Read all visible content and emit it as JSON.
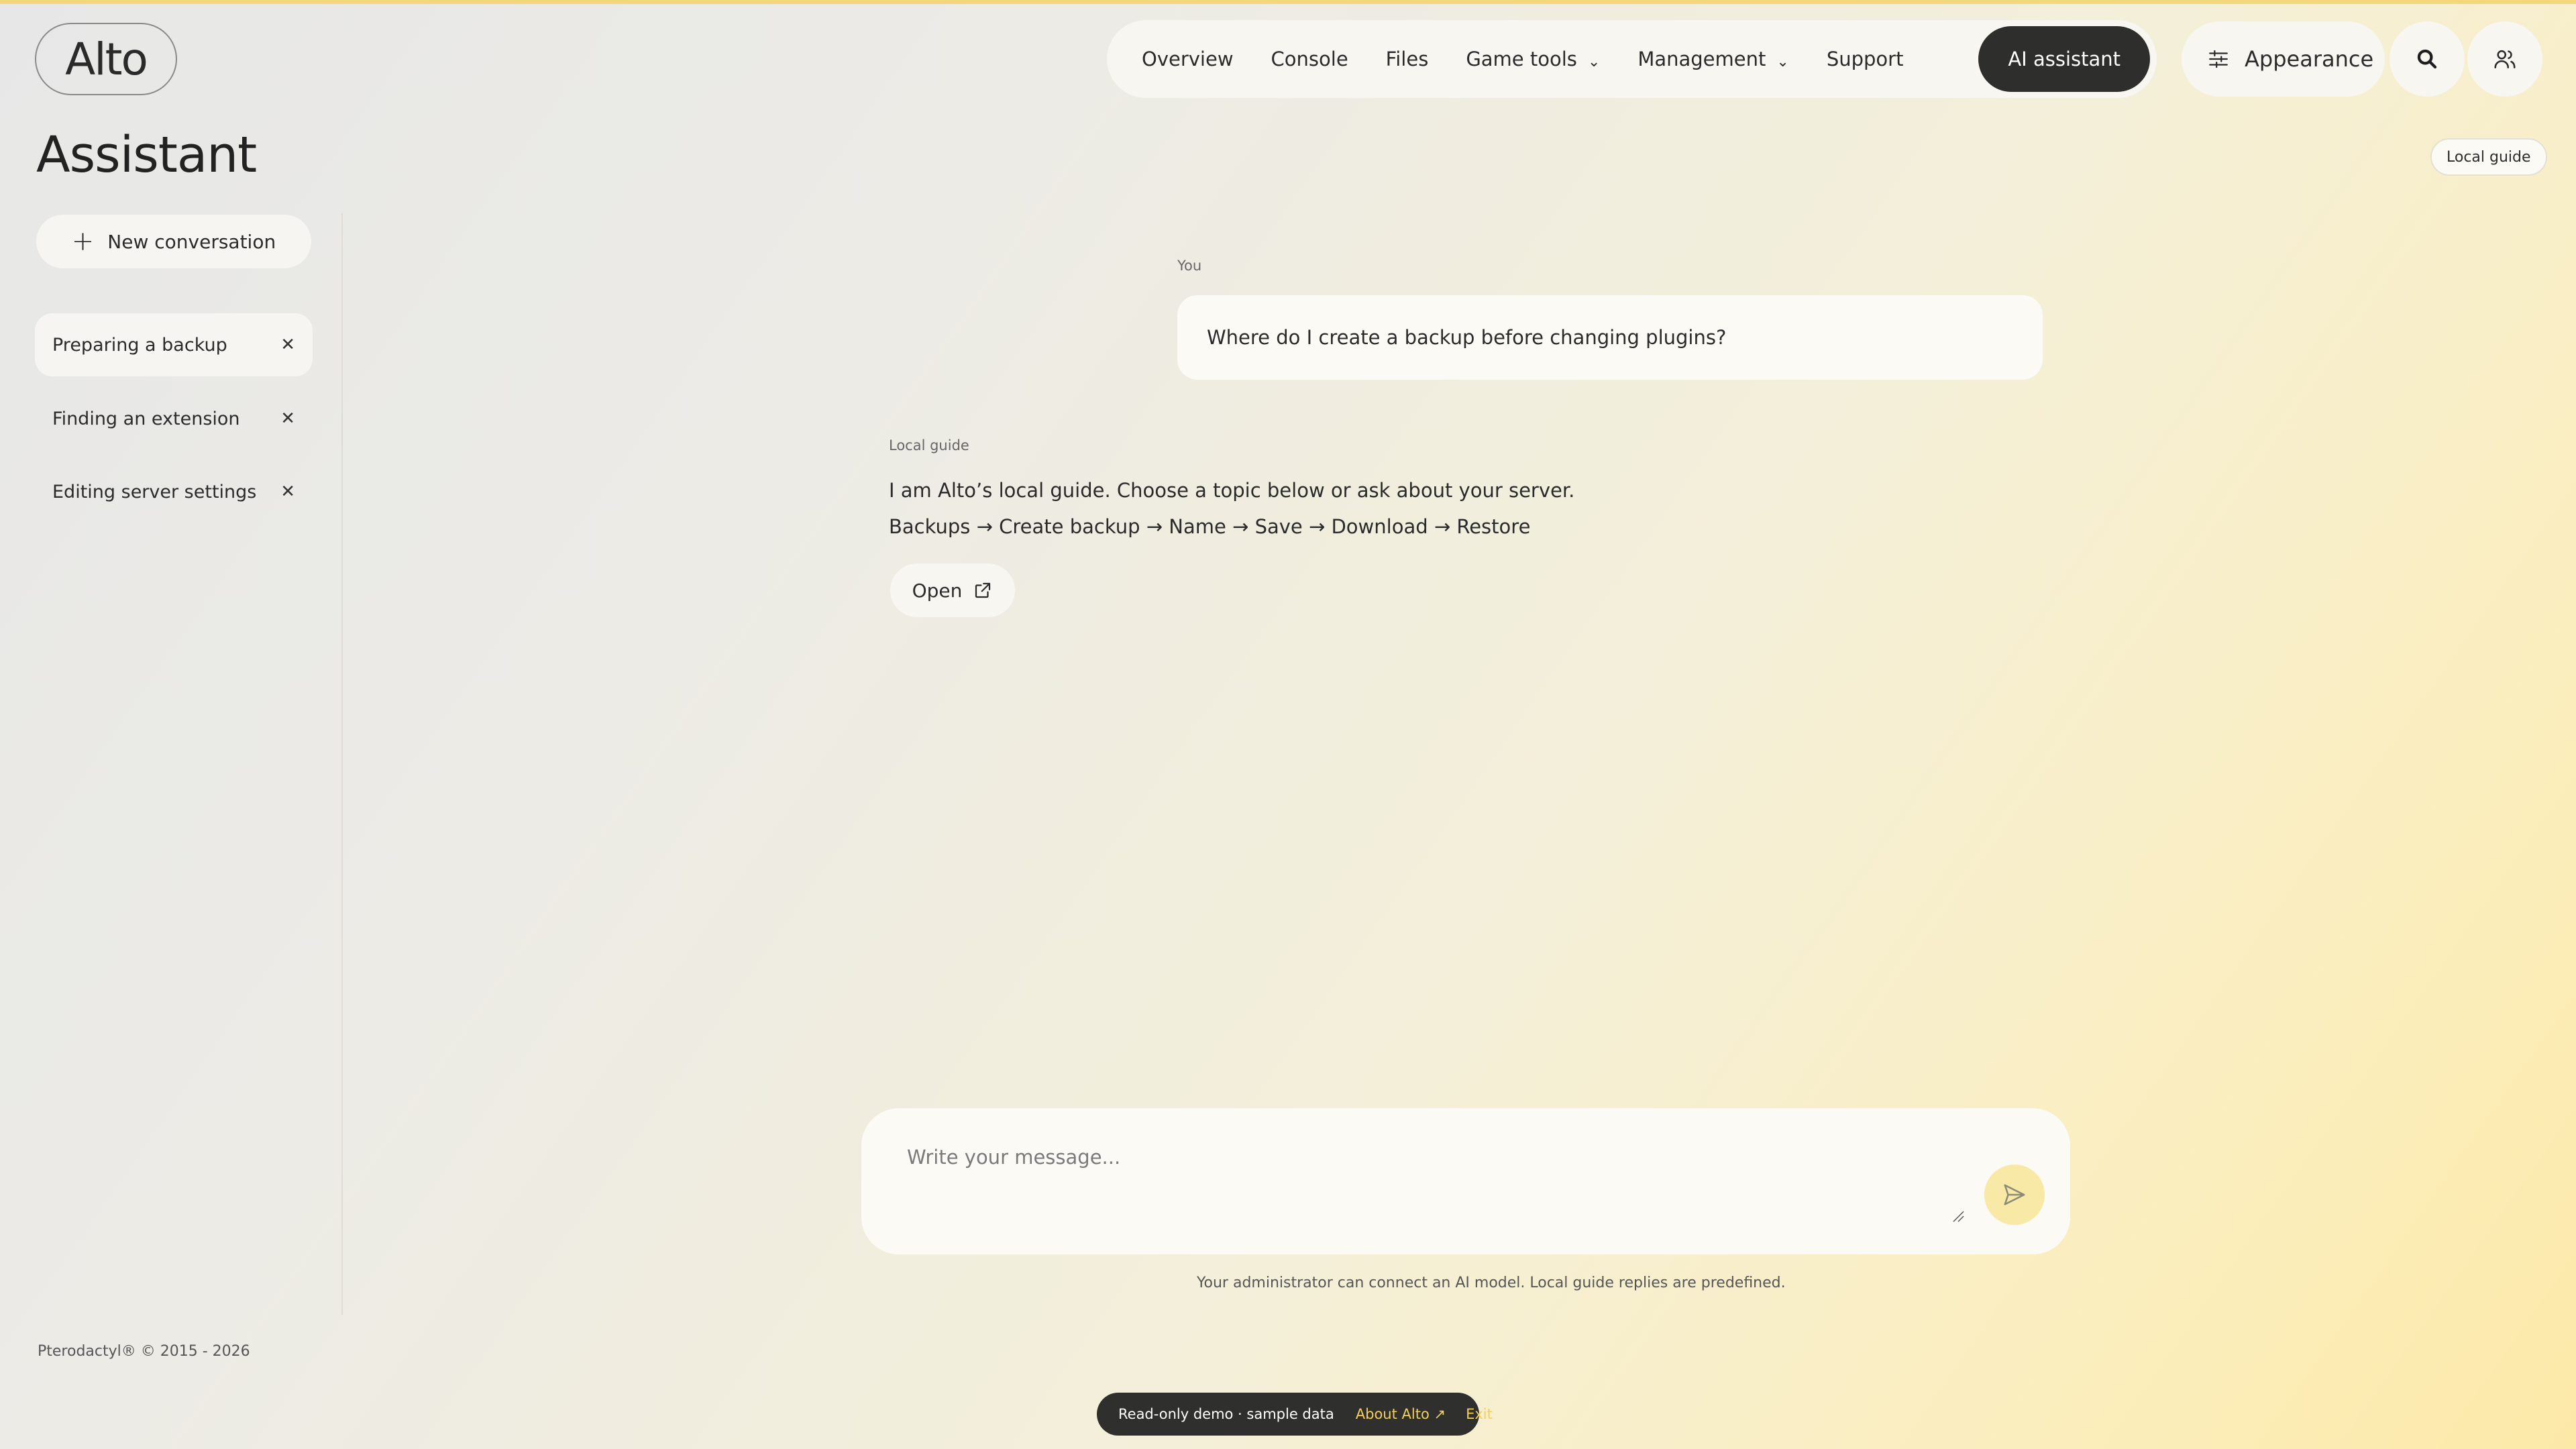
{
  "header": {
    "logo": "Alto",
    "nav": [
      {
        "label": "Overview"
      },
      {
        "label": "Console"
      },
      {
        "label": "Files"
      },
      {
        "label": "Game tools",
        "dropdown": true
      },
      {
        "label": "Management",
        "dropdown": true
      },
      {
        "label": "Support"
      },
      {
        "label": "AI assistant",
        "active": true
      }
    ],
    "appearance_label": "Appearance",
    "search_icon": "search-icon",
    "account_icon": "users-icon"
  },
  "page": {
    "title": "Assistant",
    "badge": "Local guide"
  },
  "sidebar": {
    "new_conversation": "New conversation",
    "conversations": [
      {
        "label": "Preparing a backup",
        "selected": true
      },
      {
        "label": "Finding an extension",
        "selected": false
      },
      {
        "label": "Editing server settings",
        "selected": false
      }
    ],
    "footer": "Pterodactyl® © 2015 - 2026"
  },
  "chat": {
    "user_label": "You",
    "user_message": "Where do I create a backup before changing plugins?",
    "guide_label": "Local guide",
    "guide_line1": "I am Alto’s local guide. Choose a topic below or ask about your server.",
    "guide_line2": "Backups → Create backup → Name → Save → Download → Restore",
    "open_button": "Open"
  },
  "composer": {
    "placeholder": "Write your message...",
    "note": "Your administrator can connect an AI model. Local guide replies are predefined."
  },
  "demo_bar": {
    "text": "Read-only demo · sample data",
    "about": "About Alto ↗",
    "exit": "Exit"
  },
  "colors": {
    "accent": "#f2cf5b",
    "active_nav_bg": "#2e2e2c",
    "send_button_bg": "#f8e9a6"
  }
}
